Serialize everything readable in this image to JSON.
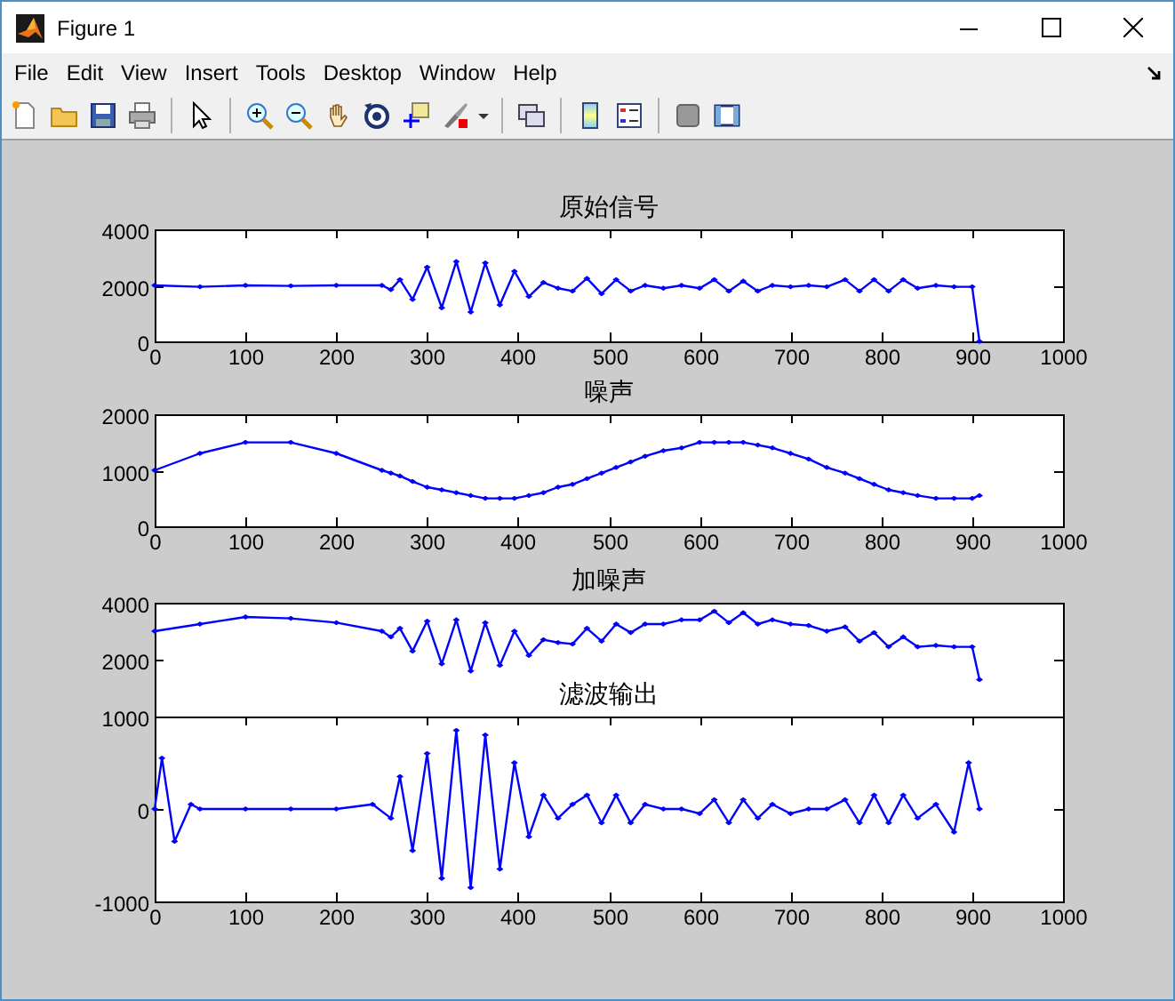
{
  "window": {
    "title": "Figure 1"
  },
  "menu": [
    {
      "label": "File"
    },
    {
      "label": "Edit"
    },
    {
      "label": "View"
    },
    {
      "label": "Insert"
    },
    {
      "label": "Tools"
    },
    {
      "label": "Desktop"
    },
    {
      "label": "Window"
    },
    {
      "label": "Help"
    }
  ],
  "axes": [
    {
      "chart_data": {
        "type": "line",
        "title": "原始信号",
        "x": [
          0,
          50,
          100,
          150,
          200,
          250,
          260,
          270,
          284,
          300,
          316,
          332,
          348,
          364,
          380,
          396,
          412,
          428,
          444,
          460,
          476,
          492,
          508,
          524,
          540,
          560,
          580,
          600,
          616,
          632,
          648,
          664,
          680,
          700,
          720,
          740,
          760,
          776,
          792,
          808,
          824,
          840,
          860,
          880,
          900,
          908
        ],
        "series": [
          {
            "color": "#0000ff",
            "values": [
              2000,
              1950,
              2000,
              1980,
              2000,
              2000,
              1850,
              2200,
              1500,
              2650,
              1200,
              2850,
              1050,
              2800,
              1300,
              2500,
              1600,
              2100,
              1900,
              1800,
              2250,
              1700,
              2200,
              1800,
              2000,
              1900,
              2000,
              1900,
              2200,
              1800,
              2150,
              1800,
              2000,
              1950,
              2000,
              1950,
              2200,
              1800,
              2200,
              1800,
              2200,
              1900,
              2000,
              1950,
              1950,
              0
            ]
          }
        ],
        "xlim": [
          0,
          1000
        ],
        "ylim": [
          0,
          4000
        ],
        "xticks": [
          0,
          100,
          200,
          300,
          400,
          500,
          600,
          700,
          800,
          900,
          1000
        ],
        "yticks": [
          0,
          2000,
          4000
        ]
      }
    },
    {
      "chart_data": {
        "type": "line",
        "title": "噪声",
        "x": [
          0,
          50,
          100,
          150,
          200,
          250,
          260,
          270,
          284,
          300,
          316,
          332,
          348,
          364,
          380,
          396,
          412,
          428,
          444,
          460,
          476,
          492,
          508,
          524,
          540,
          560,
          580,
          600,
          616,
          632,
          648,
          664,
          680,
          700,
          720,
          740,
          760,
          776,
          792,
          808,
          824,
          840,
          860,
          880,
          900,
          908
        ],
        "series": [
          {
            "color": "#0000ff",
            "values": [
              1000,
              1300,
              1500,
              1500,
              1300,
              1000,
              950,
              900,
              800,
              700,
              650,
              600,
              550,
              500,
              500,
              500,
              550,
              600,
              700,
              750,
              850,
              950,
              1050,
              1150,
              1250,
              1350,
              1400,
              1500,
              1500,
              1500,
              1500,
              1450,
              1400,
              1300,
              1200,
              1050,
              950,
              850,
              750,
              650,
              600,
              550,
              500,
              500,
              500,
              550
            ]
          }
        ],
        "xlim": [
          0,
          1000
        ],
        "ylim": [
          0,
          2000
        ],
        "xticks": [
          0,
          100,
          200,
          300,
          400,
          500,
          600,
          700,
          800,
          900,
          1000
        ],
        "yticks": [
          0,
          1000,
          2000
        ]
      }
    },
    {
      "chart_data": {
        "type": "line",
        "title": "加噪声",
        "x": [
          0,
          50,
          100,
          150,
          200,
          250,
          260,
          270,
          284,
          300,
          316,
          332,
          348,
          364,
          380,
          396,
          412,
          428,
          444,
          460,
          476,
          492,
          508,
          524,
          540,
          560,
          580,
          600,
          616,
          632,
          648,
          664,
          680,
          700,
          720,
          740,
          760,
          776,
          792,
          808,
          824,
          840,
          860,
          880,
          900,
          908
        ],
        "series": [
          {
            "color": "#0000ff",
            "values": [
              3000,
              3250,
              3500,
              3450,
              3300,
              3000,
              2800,
              3100,
              2300,
              3350,
              1850,
              3400,
              1600,
              3300,
              1800,
              3000,
              2150,
              2700,
              2600,
              2550,
              3100,
              2650,
              3250,
              2950,
              3250,
              3250,
              3400,
              3400,
              3700,
              3300,
              3650,
              3250,
              3400,
              3250,
              3200,
              3000,
              3150,
              2650,
              2950,
              2450,
              2800,
              2450,
              2500,
              2450,
              2450,
              1300
            ]
          }
        ],
        "xlim": [
          0,
          1000
        ],
        "ylim": [
          0,
          4000
        ],
        "yticks": [
          2000,
          4000
        ]
      }
    },
    {
      "chart_data": {
        "type": "line",
        "title": "滤波输出",
        "x": [
          0,
          8,
          22,
          40,
          50,
          100,
          150,
          200,
          240,
          260,
          270,
          284,
          300,
          316,
          332,
          348,
          364,
          380,
          396,
          412,
          428,
          444,
          460,
          476,
          492,
          508,
          524,
          540,
          560,
          580,
          600,
          616,
          632,
          648,
          664,
          680,
          700,
          720,
          740,
          760,
          776,
          792,
          808,
          824,
          840,
          860,
          880,
          896,
          908
        ],
        "series": [
          {
            "color": "#0000ff",
            "values": [
              0,
              550,
              -350,
              50,
              0,
              0,
              0,
              0,
              50,
              -100,
              350,
              -450,
              600,
              -750,
              850,
              -850,
              800,
              -650,
              500,
              -300,
              150,
              -100,
              50,
              150,
              -150,
              150,
              -150,
              50,
              0,
              0,
              -50,
              100,
              -150,
              100,
              -100,
              50,
              -50,
              0,
              0,
              100,
              -150,
              150,
              -150,
              150,
              -100,
              50,
              -250,
              500,
              0
            ]
          }
        ],
        "xlim": [
          0,
          1000
        ],
        "ylim": [
          -1000,
          1000
        ],
        "xticks": [
          0,
          100,
          200,
          300,
          400,
          500,
          600,
          700,
          800,
          900,
          1000
        ],
        "yticks": [
          -1000,
          0,
          1000
        ]
      }
    }
  ]
}
